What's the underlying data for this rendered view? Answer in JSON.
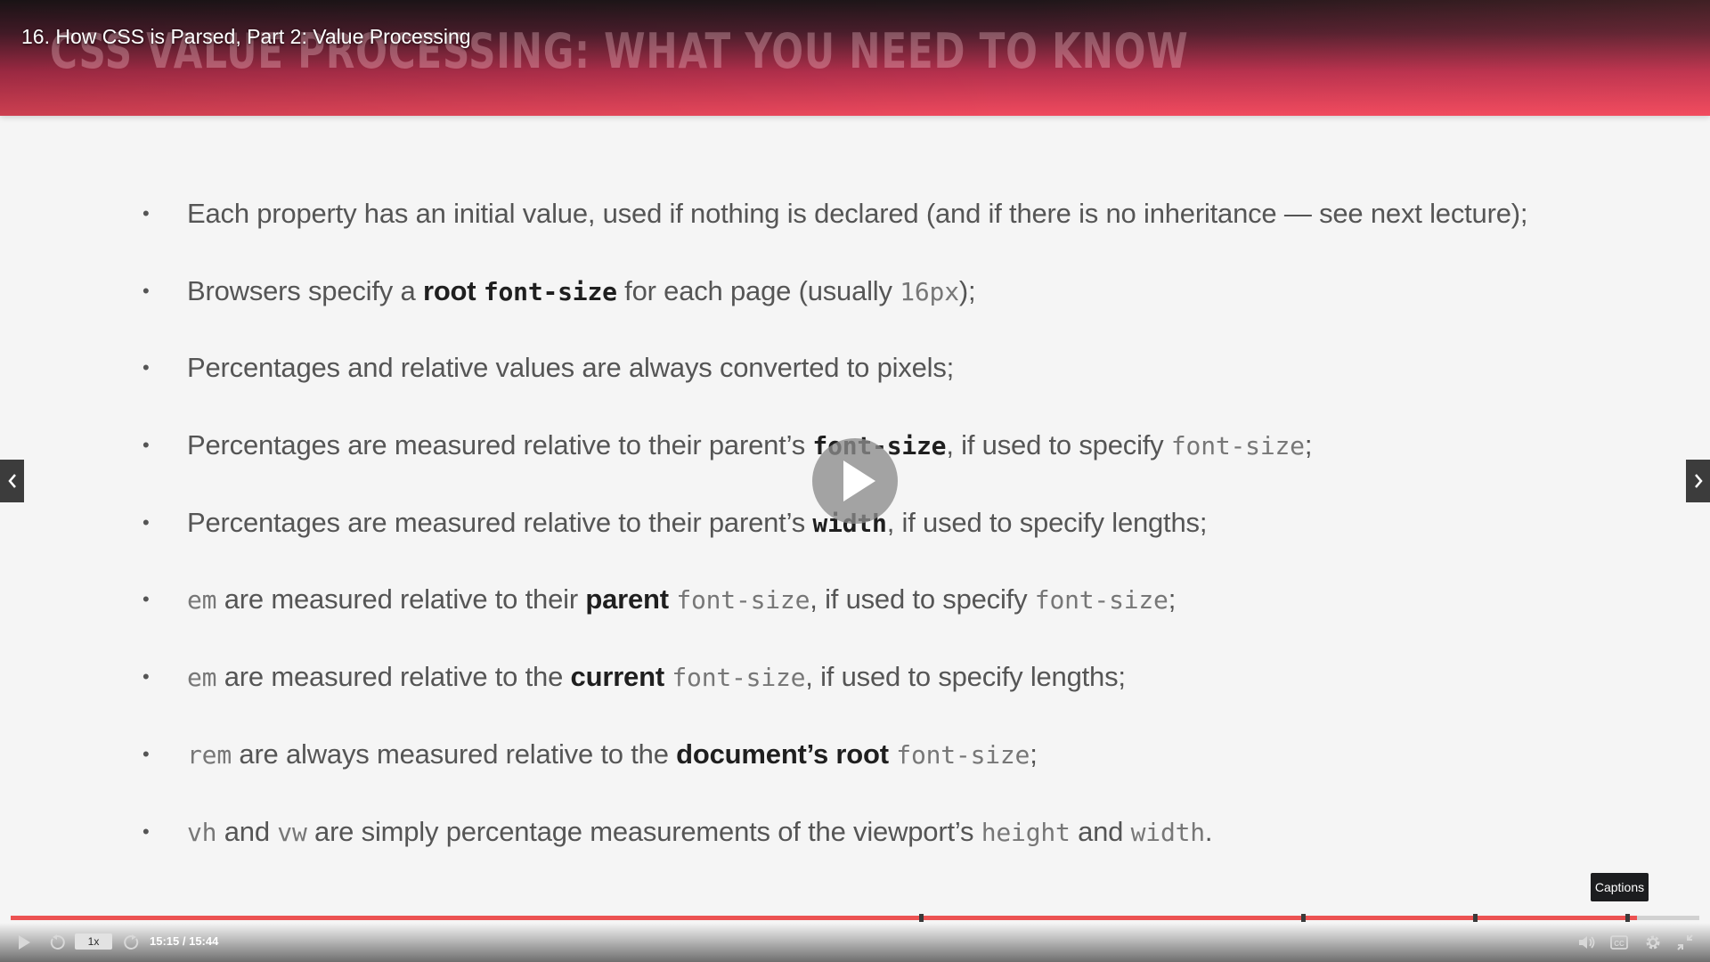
{
  "player": {
    "video_title": "16. How CSS is Parsed, Part 2: Value Processing",
    "tooltip": "Captions",
    "playback_rate": "1x",
    "time": {
      "current": "15:15",
      "separator": " / ",
      "duration": "15:44"
    },
    "progress_fraction": 0.963,
    "chapter_markers_fraction": [
      0.538,
      0.764,
      0.866,
      0.956
    ],
    "accent_color": "#ec5252",
    "icons": {
      "big_play": "play-icon",
      "prev": "chevron-left-icon",
      "next": "chevron-right-icon",
      "controls": [
        "play-icon",
        "rewind-icon",
        "forward-icon",
        "volume-icon",
        "captions-icon",
        "gear-icon",
        "exit-fullscreen-icon"
      ]
    }
  },
  "slide": {
    "heading": "CSS VALUE PROCESSING: WHAT YOU NEED TO KNOW",
    "bullet_symbol": "•",
    "bullets": [
      [
        {
          "t": "Each property has an initial value, used if nothing is declared (and if there is no inheritance — see next lecture);",
          "s": "n"
        }
      ],
      [
        {
          "t": "Browsers specify a ",
          "s": "n"
        },
        {
          "t": "root",
          "s": "b"
        },
        {
          "t": " ",
          "s": "n"
        },
        {
          "t": "font-size",
          "s": "cb"
        },
        {
          "t": " for each page (usually ",
          "s": "n"
        },
        {
          "t": "16px",
          "s": "c"
        },
        {
          "t": ");",
          "s": "n"
        }
      ],
      [
        {
          "t": "Percentages and relative values are always converted to pixels;",
          "s": "n"
        }
      ],
      [
        {
          "t": "Percentages are measured relative to their parent’s ",
          "s": "n"
        },
        {
          "t": "font-size",
          "s": "cb"
        },
        {
          "t": ", if used to specify ",
          "s": "n"
        },
        {
          "t": "font-size",
          "s": "c"
        },
        {
          "t": ";",
          "s": "n"
        }
      ],
      [
        {
          "t": "Percentages are measured relative to their parent’s ",
          "s": "n"
        },
        {
          "t": "width",
          "s": "cb"
        },
        {
          "t": ", if used to specify lengths;",
          "s": "n"
        }
      ],
      [
        {
          "t": "em",
          "s": "c"
        },
        {
          "t": " are measured relative to their ",
          "s": "n"
        },
        {
          "t": "parent",
          "s": "b"
        },
        {
          "t": " ",
          "s": "n"
        },
        {
          "t": "font-size",
          "s": "c"
        },
        {
          "t": ", if used to specify ",
          "s": "n"
        },
        {
          "t": "font-size",
          "s": "c"
        },
        {
          "t": ";",
          "s": "n"
        }
      ],
      [
        {
          "t": "em",
          "s": "c"
        },
        {
          "t": " are measured relative to the ",
          "s": "n"
        },
        {
          "t": "current",
          "s": "b"
        },
        {
          "t": " ",
          "s": "n"
        },
        {
          "t": "font-size",
          "s": "c"
        },
        {
          "t": ", if used to specify lengths;",
          "s": "n"
        }
      ],
      [
        {
          "t": "rem",
          "s": "c"
        },
        {
          "t": " are always measured relative to the ",
          "s": "n"
        },
        {
          "t": "document’s root",
          "s": "b"
        },
        {
          "t": " ",
          "s": "n"
        },
        {
          "t": "font-size",
          "s": "c"
        },
        {
          "t": ";",
          "s": "n"
        }
      ],
      [
        {
          "t": "vh",
          "s": "c"
        },
        {
          "t": " and ",
          "s": "n"
        },
        {
          "t": "vw",
          "s": "c"
        },
        {
          "t": " are simply percentage measurements of the viewport’s ",
          "s": "n"
        },
        {
          "t": "height",
          "s": "c"
        },
        {
          "t": " and ",
          "s": "n"
        },
        {
          "t": "width",
          "s": "c"
        },
        {
          "t": ".",
          "s": "n"
        }
      ]
    ]
  }
}
